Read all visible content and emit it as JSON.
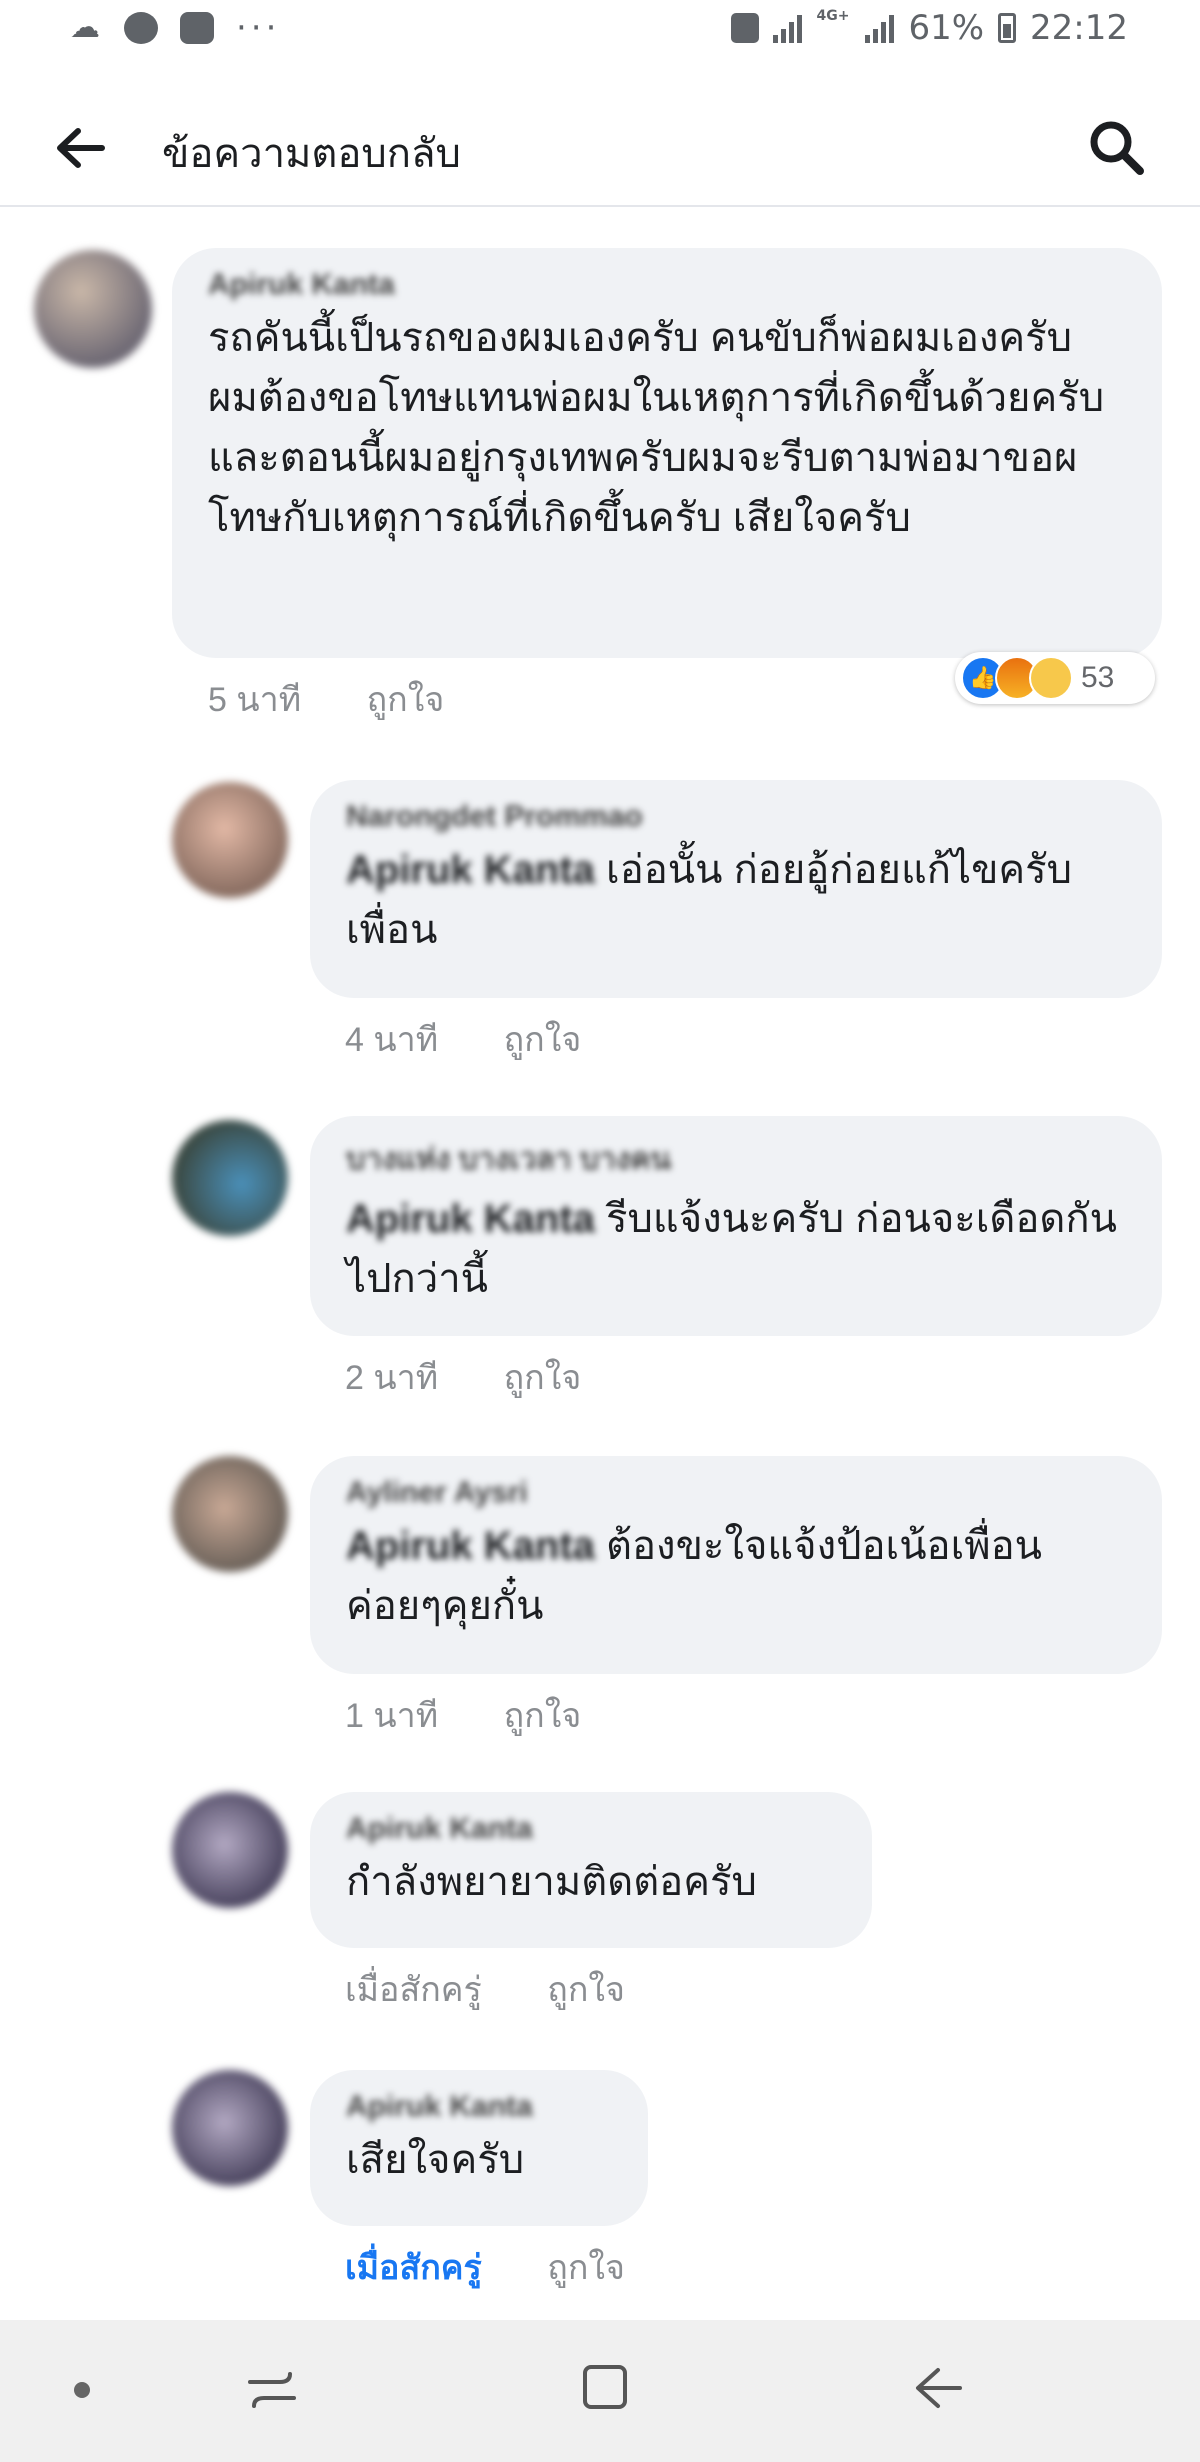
{
  "status_bar": {
    "battery": "61%",
    "time": "22:12",
    "network": "4G+",
    "icons": [
      "app-notification-icon",
      "line-icon",
      "chat-icon",
      "more-dots-icon",
      "sim-icon",
      "signal-icon",
      "battery-icon"
    ]
  },
  "app_bar": {
    "title": "ข้อความตอบกลับ",
    "back_icon": "arrow-left-icon",
    "search_icon": "search-icon"
  },
  "comments": [
    {
      "author": "Apiruk Kanta",
      "text": "รถคันนี้เป็นรถของผมเองครับ คนขับก็พ่อผมเองครับ ผมต้องขอโทษแทนพ่อผมในเหตุการที่เกิดขึ้นด้วยครับ และตอนนี้ผมอยู่กรุงเทพครับผมจะรีบตามพ่อมาขอผโทษกับเหตุการณ์ที่เกิดขึ้นครับ เสียใจครับ",
      "time": "5 นาที",
      "like": "ถูกใจ",
      "reactions": {
        "icons": [
          "like",
          "angry",
          "sad"
        ],
        "count": "53"
      }
    },
    {
      "author": "Narongdet Prommao",
      "mention": "Apiruk Kanta",
      "text": " เอ่อนั้น ก่อยอู้ก่อยแก้ไขครับเพื่อน",
      "time": "4 นาที",
      "like": "ถูกใจ"
    },
    {
      "author": "บางแห่ง บางเวลา บางคน",
      "mention": "Apiruk Kanta",
      "text": " รีบแจ้งนะครับ ก่อนจะเดือดกันไปกว่านี้",
      "time": "2 นาที",
      "like": "ถูกใจ"
    },
    {
      "author": "Ayliner Aysri",
      "mention": "Apiruk Kanta",
      "text": " ต้องขะใจแจ้งป้อเน้อเพื่อน ค่อยๆคุยกั๋น",
      "time": "1 นาที",
      "like": "ถูกใจ"
    },
    {
      "author": "Apiruk Kanta",
      "text": "กำลังพยายามติดต่อครับ",
      "time": "เมื่อสักครู่",
      "like": "ถูกใจ"
    },
    {
      "author": "Apiruk Kanta",
      "text": "เสียใจครับ",
      "time": "เมื่อสักครู่",
      "like": "ถูกใจ"
    }
  ],
  "colors": {
    "bubble": "#f0f2f5",
    "meta": "#8a8d91",
    "accent": "#1877f2"
  },
  "nav_bar": {
    "icons": [
      "dot-icon",
      "recent-apps-icon",
      "home-icon",
      "back-icon"
    ]
  }
}
